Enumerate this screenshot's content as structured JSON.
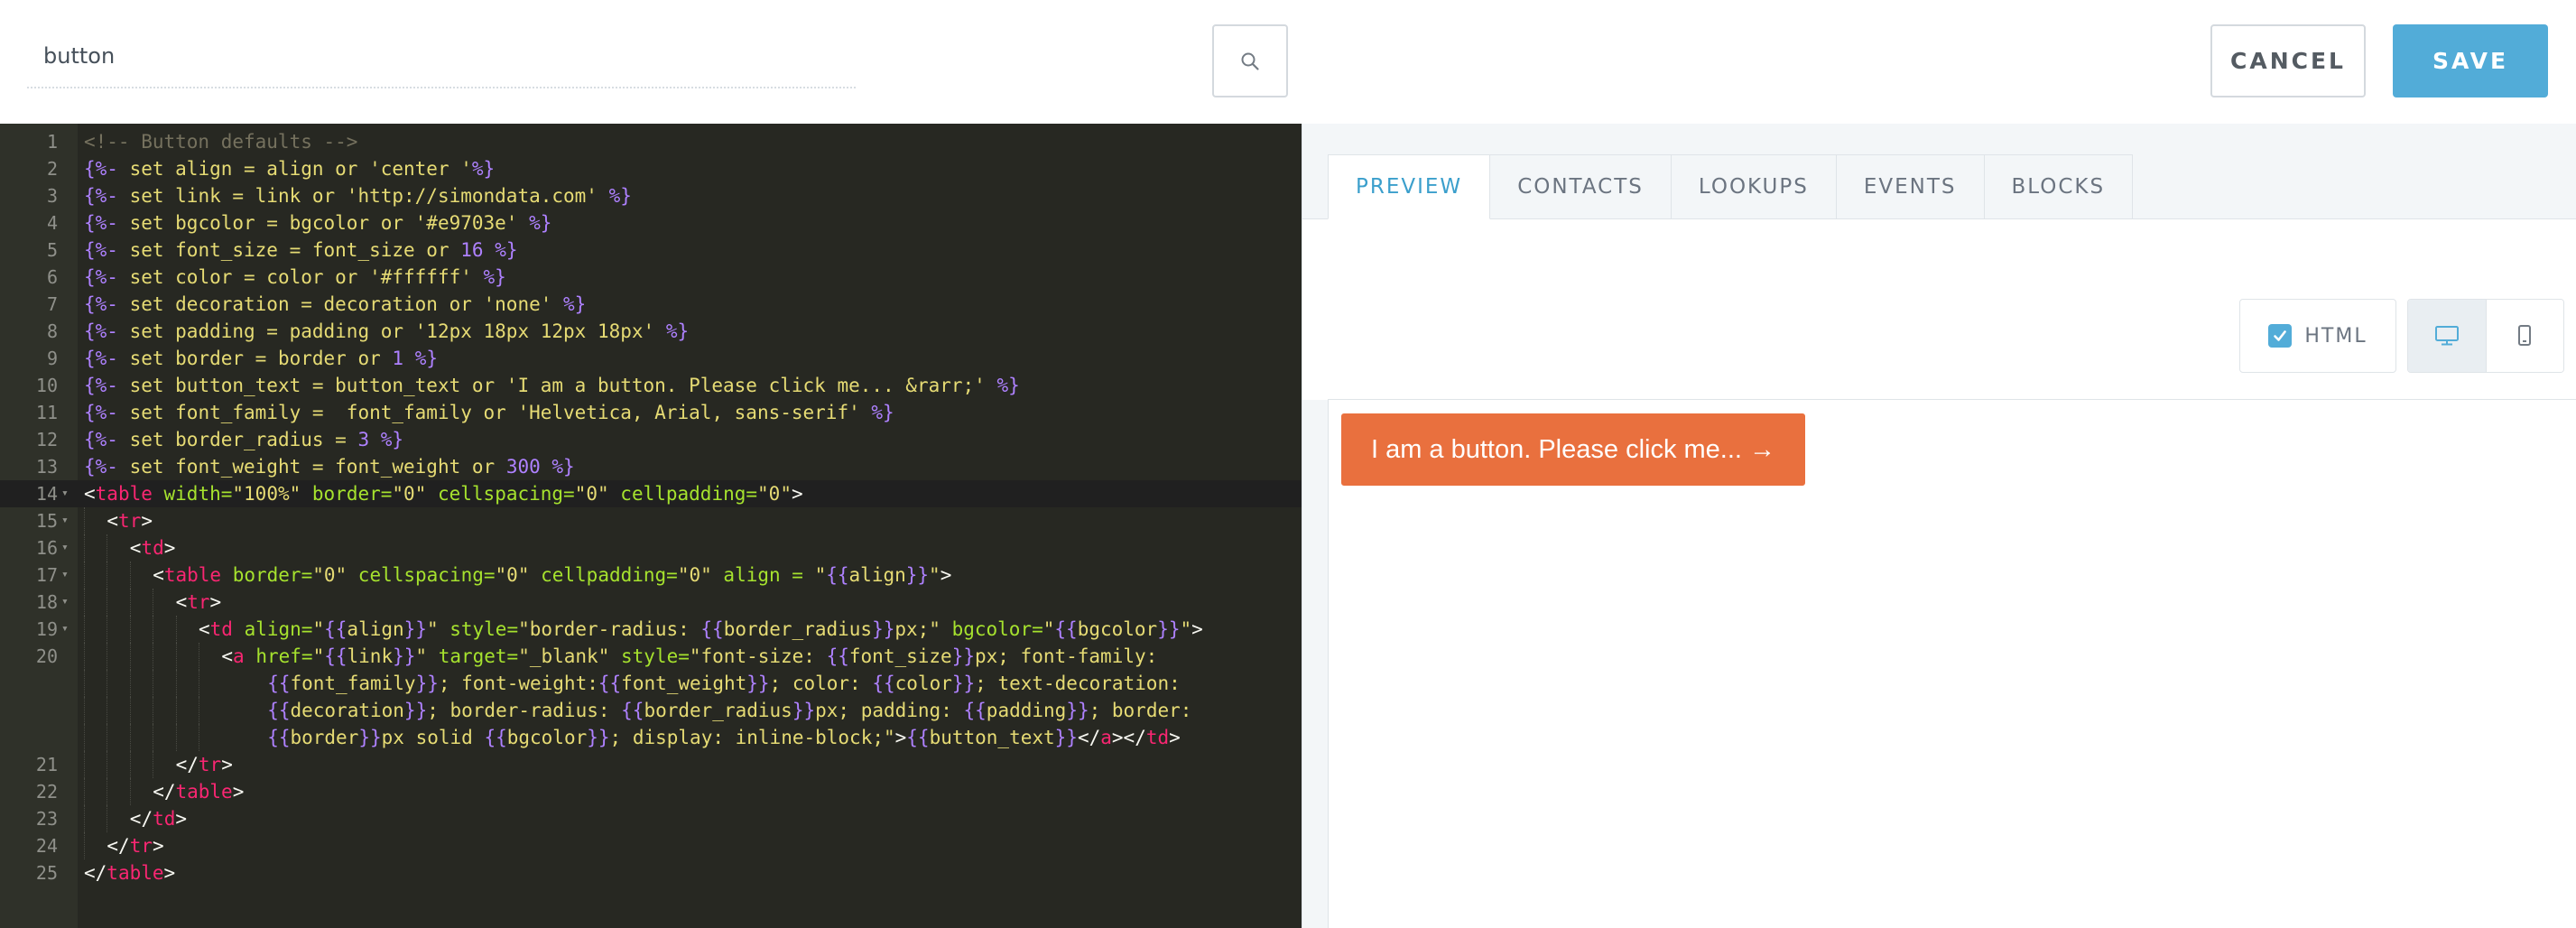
{
  "topbar": {
    "name_value": "button",
    "search_icon": "search-icon",
    "cancel_label": "CANCEL",
    "save_label": "SAVE"
  },
  "editor": {
    "lines": [
      {
        "n": "1",
        "fold": "",
        "indent": 0,
        "tokens": [
          [
            "cm",
            "<!-- Button defaults -->"
          ]
        ]
      },
      {
        "n": "2",
        "fold": "",
        "indent": 0,
        "tokens": [
          [
            "dl",
            "{%-"
          ],
          [
            "st",
            " set align = align or 'center '"
          ],
          [
            "dl",
            "%}"
          ]
        ]
      },
      {
        "n": "3",
        "fold": "",
        "indent": 0,
        "tokens": [
          [
            "dl",
            "{%-"
          ],
          [
            "st",
            " set link = link or 'http://simondata.com' "
          ],
          [
            "dl",
            "%}"
          ]
        ]
      },
      {
        "n": "4",
        "fold": "",
        "indent": 0,
        "tokens": [
          [
            "dl",
            "{%-"
          ],
          [
            "st",
            " set bgcolor = bgcolor or '#e9703e' "
          ],
          [
            "dl",
            "%}"
          ]
        ]
      },
      {
        "n": "5",
        "fold": "",
        "indent": 0,
        "tokens": [
          [
            "dl",
            "{%-"
          ],
          [
            "st",
            " set font_size = font_size or "
          ],
          [
            "nm",
            "16"
          ],
          [
            "st",
            " "
          ],
          [
            "dl",
            "%}"
          ]
        ]
      },
      {
        "n": "6",
        "fold": "",
        "indent": 0,
        "tokens": [
          [
            "dl",
            "{%-"
          ],
          [
            "st",
            " set color = color or '#ffffff' "
          ],
          [
            "dl",
            "%}"
          ]
        ]
      },
      {
        "n": "7",
        "fold": "",
        "indent": 0,
        "tokens": [
          [
            "dl",
            "{%-"
          ],
          [
            "st",
            " set decoration = decoration or 'none' "
          ],
          [
            "dl",
            "%}"
          ]
        ]
      },
      {
        "n": "8",
        "fold": "",
        "indent": 0,
        "tokens": [
          [
            "dl",
            "{%-"
          ],
          [
            "st",
            " set padding = padding or '12px 18px 12px 18px' "
          ],
          [
            "dl",
            "%}"
          ]
        ]
      },
      {
        "n": "9",
        "fold": "",
        "indent": 0,
        "tokens": [
          [
            "dl",
            "{%-"
          ],
          [
            "st",
            " set border = border or "
          ],
          [
            "nm",
            "1"
          ],
          [
            "st",
            " "
          ],
          [
            "dl",
            "%}"
          ]
        ]
      },
      {
        "n": "10",
        "fold": "",
        "indent": 0,
        "tokens": [
          [
            "dl",
            "{%-"
          ],
          [
            "st",
            " set button_text = button_text or 'I am a button. Please click me... &rarr;' "
          ],
          [
            "dl",
            "%}"
          ]
        ]
      },
      {
        "n": "11",
        "fold": "",
        "indent": 0,
        "tokens": [
          [
            "dl",
            "{%-"
          ],
          [
            "st",
            " set font_family =  font_family or 'Helvetica, Arial, sans-serif' "
          ],
          [
            "dl",
            "%}"
          ]
        ]
      },
      {
        "n": "12",
        "fold": "",
        "indent": 0,
        "tokens": [
          [
            "dl",
            "{%-"
          ],
          [
            "st",
            " set border_radius = "
          ],
          [
            "nm",
            "3"
          ],
          [
            "st",
            " "
          ],
          [
            "dl",
            "%}"
          ]
        ]
      },
      {
        "n": "13",
        "fold": "",
        "indent": 0,
        "tokens": [
          [
            "dl",
            "{%-"
          ],
          [
            "st",
            " set font_weight = font_weight or "
          ],
          [
            "nm",
            "300"
          ],
          [
            "st",
            " "
          ],
          [
            "dl",
            "%}"
          ]
        ]
      },
      {
        "n": "14",
        "fold": "▾",
        "indent": 0,
        "tokens": [
          [
            "tx",
            "<"
          ],
          [
            "tg",
            "table"
          ],
          [
            "at",
            " width="
          ],
          [
            "st",
            "\"100%\""
          ],
          [
            "at",
            " border="
          ],
          [
            "st",
            "\"0\""
          ],
          [
            "at",
            " cellspacing="
          ],
          [
            "st",
            "\"0\""
          ],
          [
            "at",
            " cellpadding="
          ],
          [
            "st",
            "\"0\""
          ],
          [
            "tx",
            ">"
          ]
        ]
      },
      {
        "n": "15",
        "fold": "▾",
        "indent": 1,
        "tokens": [
          [
            "tx",
            "<"
          ],
          [
            "tg",
            "tr"
          ],
          [
            "tx",
            ">"
          ]
        ]
      },
      {
        "n": "16",
        "fold": "▾",
        "indent": 2,
        "tokens": [
          [
            "tx",
            "<"
          ],
          [
            "tg",
            "td"
          ],
          [
            "tx",
            ">"
          ]
        ]
      },
      {
        "n": "17",
        "fold": "▾",
        "indent": 3,
        "tokens": [
          [
            "tx",
            "<"
          ],
          [
            "tg",
            "table"
          ],
          [
            "at",
            " border="
          ],
          [
            "st",
            "\"0\""
          ],
          [
            "at",
            " cellspacing="
          ],
          [
            "st",
            "\"0\""
          ],
          [
            "at",
            " cellpadding="
          ],
          [
            "st",
            "\"0\""
          ],
          [
            "at",
            " align = "
          ],
          [
            "st",
            "\""
          ],
          [
            "dl",
            "{{"
          ],
          [
            "st",
            "align"
          ],
          [
            "dl",
            "}}"
          ],
          [
            "st",
            "\""
          ],
          [
            "tx",
            ">"
          ]
        ]
      },
      {
        "n": "18",
        "fold": "▾",
        "indent": 4,
        "tokens": [
          [
            "tx",
            "<"
          ],
          [
            "tg",
            "tr"
          ],
          [
            "tx",
            ">"
          ]
        ]
      },
      {
        "n": "19",
        "fold": "▾",
        "indent": 5,
        "tokens": [
          [
            "tx",
            "<"
          ],
          [
            "tg",
            "td"
          ],
          [
            "at",
            " align="
          ],
          [
            "st",
            "\""
          ],
          [
            "dl",
            "{{"
          ],
          [
            "st",
            "align"
          ],
          [
            "dl",
            "}}"
          ],
          [
            "st",
            "\""
          ],
          [
            "at",
            " style="
          ],
          [
            "st",
            "\"border-radius: "
          ],
          [
            "dl",
            "{{"
          ],
          [
            "st",
            "border_radius"
          ],
          [
            "dl",
            "}}"
          ],
          [
            "st",
            "px;\""
          ],
          [
            "at",
            " bgcolor="
          ],
          [
            "st",
            "\""
          ],
          [
            "dl",
            "{{"
          ],
          [
            "st",
            "bgcolor"
          ],
          [
            "dl",
            "}}"
          ],
          [
            "st",
            "\""
          ],
          [
            "tx",
            ">"
          ]
        ]
      },
      {
        "n": "20",
        "fold": "",
        "indent": 6,
        "tokens": [
          [
            "tx",
            "<"
          ],
          [
            "tg",
            "a"
          ],
          [
            "at",
            " href="
          ],
          [
            "st",
            "\""
          ],
          [
            "dl",
            "{{"
          ],
          [
            "st",
            "link"
          ],
          [
            "dl",
            "}}"
          ],
          [
            "st",
            "\""
          ],
          [
            "at",
            " target="
          ],
          [
            "st",
            "\"_blank\""
          ],
          [
            "at",
            " style="
          ],
          [
            "st",
            "\"font-size: "
          ],
          [
            "dl",
            "{{"
          ],
          [
            "st",
            "font_size"
          ],
          [
            "dl",
            "}}"
          ],
          [
            "st",
            "px; font-family:"
          ]
        ]
      },
      {
        "n": "",
        "fold": "",
        "indent": 8,
        "tokens": [
          [
            "dl",
            "{{"
          ],
          [
            "st",
            "font_family"
          ],
          [
            "dl",
            "}}"
          ],
          [
            "st",
            "; font-weight:"
          ],
          [
            "dl",
            "{{"
          ],
          [
            "st",
            "font_weight"
          ],
          [
            "dl",
            "}}"
          ],
          [
            "st",
            "; color: "
          ],
          [
            "dl",
            "{{"
          ],
          [
            "st",
            "color"
          ],
          [
            "dl",
            "}}"
          ],
          [
            "st",
            "; text-decoration:"
          ]
        ]
      },
      {
        "n": "",
        "fold": "",
        "indent": 8,
        "tokens": [
          [
            "dl",
            "{{"
          ],
          [
            "st",
            "decoration"
          ],
          [
            "dl",
            "}}"
          ],
          [
            "st",
            "; border-radius: "
          ],
          [
            "dl",
            "{{"
          ],
          [
            "st",
            "border_radius"
          ],
          [
            "dl",
            "}}"
          ],
          [
            "st",
            "px; padding: "
          ],
          [
            "dl",
            "{{"
          ],
          [
            "st",
            "padding"
          ],
          [
            "dl",
            "}}"
          ],
          [
            "st",
            "; border:"
          ]
        ]
      },
      {
        "n": "",
        "fold": "",
        "indent": 8,
        "tokens": [
          [
            "dl",
            "{{"
          ],
          [
            "st",
            "border"
          ],
          [
            "dl",
            "}}"
          ],
          [
            "st",
            "px solid "
          ],
          [
            "dl",
            "{{"
          ],
          [
            "st",
            "bgcolor"
          ],
          [
            "dl",
            "}}"
          ],
          [
            "st",
            "; display: inline-block;\""
          ],
          [
            "tx",
            ">"
          ],
          [
            "dl",
            "{{"
          ],
          [
            "st",
            "button_text"
          ],
          [
            "dl",
            "}}"
          ],
          [
            "tx",
            "</"
          ],
          [
            "tg",
            "a"
          ],
          [
            "tx",
            "></"
          ],
          [
            "tg",
            "td"
          ],
          [
            "tx",
            ">"
          ]
        ]
      },
      {
        "n": "21",
        "fold": "",
        "indent": 4,
        "tokens": [
          [
            "tx",
            "</"
          ],
          [
            "tg",
            "tr"
          ],
          [
            "tx",
            ">"
          ]
        ]
      },
      {
        "n": "22",
        "fold": "",
        "indent": 3,
        "tokens": [
          [
            "tx",
            "</"
          ],
          [
            "tg",
            "table"
          ],
          [
            "tx",
            ">"
          ]
        ]
      },
      {
        "n": "23",
        "fold": "",
        "indent": 2,
        "tokens": [
          [
            "tx",
            "</"
          ],
          [
            "tg",
            "td"
          ],
          [
            "tx",
            ">"
          ]
        ]
      },
      {
        "n": "24",
        "fold": "",
        "indent": 1,
        "tokens": [
          [
            "tx",
            "</"
          ],
          [
            "tg",
            "tr"
          ],
          [
            "tx",
            ">"
          ]
        ]
      },
      {
        "n": "25",
        "fold": "",
        "indent": 0,
        "tokens": [
          [
            "tx",
            "</"
          ],
          [
            "tg",
            "table"
          ],
          [
            "tx",
            ">"
          ]
        ]
      }
    ],
    "active_line": "14"
  },
  "preview": {
    "tabs": [
      {
        "label": "PREVIEW",
        "active": true
      },
      {
        "label": "CONTACTS",
        "active": false
      },
      {
        "label": "LOOKUPS",
        "active": false
      },
      {
        "label": "EVENTS",
        "active": false
      },
      {
        "label": "BLOCKS",
        "active": false
      }
    ],
    "html_label": "HTML",
    "html_checked": true,
    "desktop_icon": "desktop-icon",
    "mobile_icon": "mobile-icon",
    "button_text": "I am a button. Please click me... →",
    "colors": {
      "accent": "#52acd8",
      "button_bg": "#e9703e",
      "button_fg": "#ffffff",
      "editor_bg": "#272822"
    }
  }
}
